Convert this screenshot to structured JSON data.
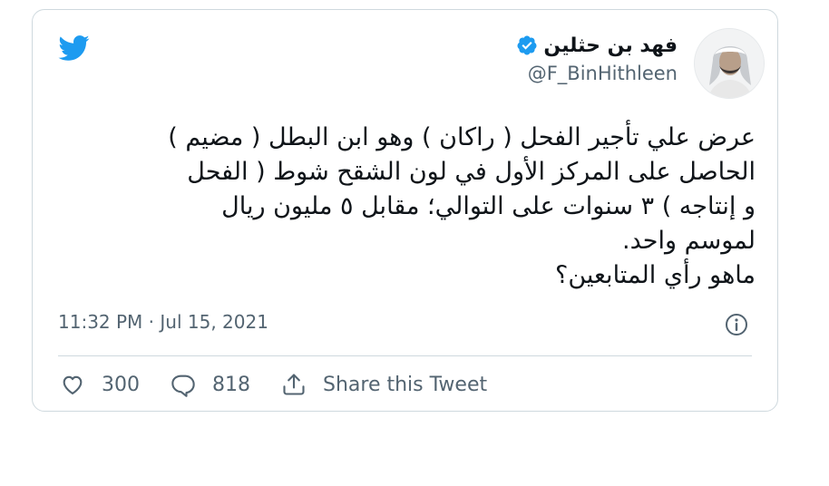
{
  "tweet": {
    "author": {
      "display_name": "فهد بن حثلين",
      "handle": "@F_BinHithleen",
      "verified": true,
      "verified_color": "#1d9bf0"
    },
    "text": "عرض علي تأجير الفحل ( راكان ) وهو ابن البطل ( مضيم )\nالحاصل على المركز الأول في لون الشقح شوط ( الفحل\nو إنتاجه ) ٣ سنوات على التوالي؛ مقابل ٥ مليون ريال\nلموسم واحد.\nماهو رأي المتابعين؟",
    "timestamp": "11:32 PM · Jul 15, 2021",
    "actions": {
      "like_count": "300",
      "reply_count": "818",
      "share_label": "Share this Tweet"
    }
  },
  "icons": {
    "logo": "twitter-bird-icon",
    "verified": "verified-badge-icon",
    "info": "info-icon",
    "like": "heart-icon",
    "reply": "reply-icon",
    "share": "share-icon"
  },
  "colors": {
    "brand": "#1d9bf0",
    "text": "#0f1419",
    "secondary": "#536471",
    "border": "#cfd9de"
  }
}
